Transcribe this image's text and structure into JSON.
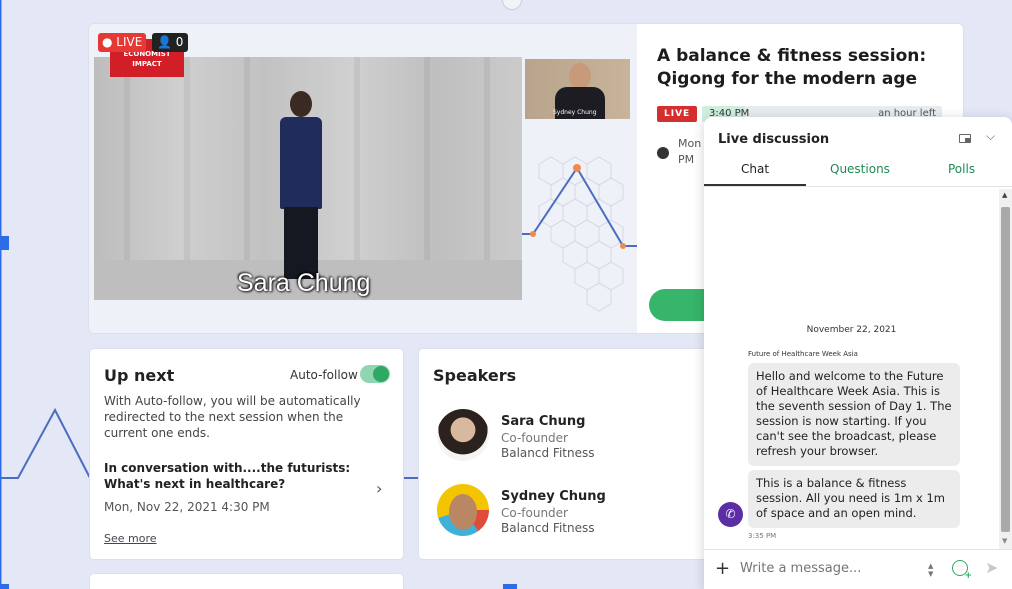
{
  "video": {
    "live_label": "LIVE",
    "viewer_count": "0",
    "sponsor_badge": "ECONOMIST IMPACT",
    "caption": "Sara Chung",
    "pip_name": "Sydney Chung"
  },
  "session": {
    "title": "A balance & fitness session: Qigong for the modern age",
    "live_tag": "LIVE",
    "start_time": "3:40 PM",
    "time_left": "an hour left",
    "progress_fraction": 0.18,
    "date_partial": "Mon PM"
  },
  "up_next": {
    "title": "Up next",
    "auto_follow_label": "Auto-follow",
    "auto_follow_on": true,
    "description": "With Auto-follow, you will be automatically redirected to the next session when the current one ends.",
    "next_title": "In conversation with....the futurists: What's next in healthcare?",
    "next_time": "Mon, Nov 22, 2021 4:30 PM",
    "see_more": "See more"
  },
  "speakers": {
    "title": "Speakers",
    "items": [
      {
        "name": "Sara Chung",
        "role": "Co-founder",
        "org": "Balancd Fitness"
      },
      {
        "name": "Sydney Chung",
        "role": "Co-founder",
        "org": "Balancd Fitness"
      }
    ]
  },
  "chat": {
    "title": "Live discussion",
    "tabs": [
      "Chat",
      "Questions",
      "Polls"
    ],
    "date_divider": "November 22, 2021",
    "sender": "Future of Healthcare Week Asia",
    "messages": [
      "Hello and welcome to the Future of Healthcare Week Asia. This is the seventh session of Day 1. The session is now starting. If you can't see the broadcast, please refresh your browser.",
      "This is a balance & fitness session. All you need is 1m x 1m of space and an open mind."
    ],
    "message_time": "3:35 PM",
    "input_placeholder": "Write a message..."
  },
  "colors": {
    "accent_green": "#2ea862",
    "live_red": "#d32f2f",
    "background": "#e4e8f6",
    "chat_avatar": "#5b2ea6"
  }
}
